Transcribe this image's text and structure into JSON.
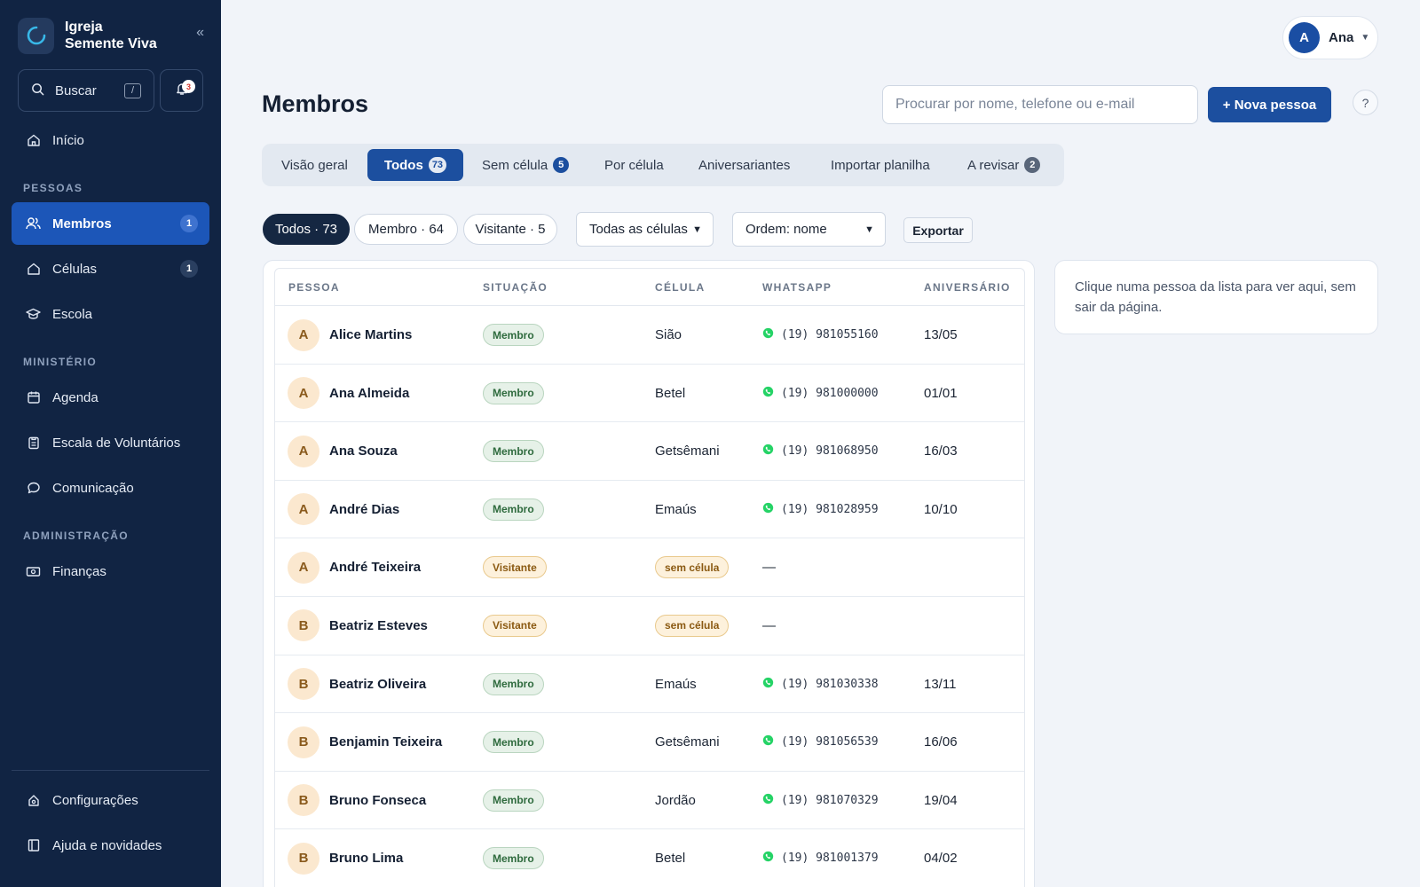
{
  "app": {
    "name": "Igreja\nSemente Viva",
    "name_line1": "Igreja",
    "name_line2": "Semente Viva"
  },
  "sidebar": {
    "search_label": "Buscar",
    "search_shortcut": "/",
    "notifications_count": "3",
    "home": "Início",
    "sections": {
      "people": "PESSOAS",
      "ministry": "MINISTÉRIO",
      "admin": "ADMINISTRAÇÃO"
    },
    "items": [
      {
        "label": "Membros",
        "count": "1",
        "icon": "users-icon",
        "active": true
      },
      {
        "label": "Células",
        "count": "1",
        "icon": "home-icon"
      },
      {
        "label": "Escola",
        "icon": "graduation-cap-icon"
      },
      {
        "label": "Agenda",
        "icon": "calendar-icon"
      },
      {
        "label": "Escala de Voluntários",
        "icon": "clipboard-icon"
      },
      {
        "label": "Comunicação",
        "icon": "chat-icon"
      },
      {
        "label": "Finanças",
        "icon": "money-icon"
      }
    ],
    "footer": [
      {
        "label": "Configurações",
        "icon": "settings-icon"
      },
      {
        "label": "Ajuda e novidades",
        "icon": "book-icon"
      }
    ]
  },
  "header": {
    "user_initial": "A",
    "user_name": "Ana",
    "title": "Membros",
    "search_placeholder": "Procurar por nome, telefone ou e-mail",
    "new_button": "+ Nova pessoa",
    "help": "?"
  },
  "tabs": [
    {
      "label": "Visão geral"
    },
    {
      "label": "Todos",
      "badge": "73",
      "active": true
    },
    {
      "label": "Sem célula",
      "badge": "5"
    },
    {
      "label": "Por célula"
    },
    {
      "label": "Aniversariantes"
    },
    {
      "label": "Importar planilha"
    },
    {
      "label": "A revisar",
      "badge": "2"
    }
  ],
  "filters": {
    "pills": [
      "Todos · 73",
      "Membro · 64",
      "Visitante · 5"
    ],
    "cell_select": "Todas as células",
    "order_select": "Ordem: nome",
    "export": "Exportar"
  },
  "table": {
    "headers": [
      "PESSOA",
      "SITUAÇÃO",
      "CÉLULA",
      "WHATSAPP",
      "ANIVERSÁRIO"
    ],
    "rows": [
      {
        "initial": "A",
        "name": "Alice Martins",
        "status": "Membro",
        "cell": "Sião",
        "whatsapp": "(19) 981055160",
        "birthday": "13/05"
      },
      {
        "initial": "A",
        "name": "Ana Almeida",
        "status": "Membro",
        "cell": "Betel",
        "whatsapp": "(19) 981000000",
        "birthday": "01/01"
      },
      {
        "initial": "A",
        "name": "Ana Souza",
        "status": "Membro",
        "cell": "Getsêmani",
        "whatsapp": "(19) 981068950",
        "birthday": "16/03"
      },
      {
        "initial": "A",
        "name": "André Dias",
        "status": "Membro",
        "cell": "Emaús",
        "whatsapp": "(19) 981028959",
        "birthday": "10/10"
      },
      {
        "initial": "A",
        "name": "André Teixeira",
        "status": "Visitante",
        "cell": "sem célula",
        "whatsapp": "—",
        "birthday": ""
      },
      {
        "initial": "B",
        "name": "Beatriz Esteves",
        "status": "Visitante",
        "cell": "sem célula",
        "whatsapp": "—",
        "birthday": ""
      },
      {
        "initial": "B",
        "name": "Beatriz Oliveira",
        "status": "Membro",
        "cell": "Emaús",
        "whatsapp": "(19) 981030338",
        "birthday": "13/11"
      },
      {
        "initial": "B",
        "name": "Benjamin Teixeira",
        "status": "Membro",
        "cell": "Getsêmani",
        "whatsapp": "(19) 981056539",
        "birthday": "16/06"
      },
      {
        "initial": "B",
        "name": "Bruno Fonseca",
        "status": "Membro",
        "cell": "Jordão",
        "whatsapp": "(19) 981070329",
        "birthday": "19/04"
      },
      {
        "initial": "B",
        "name": "Bruno Lima",
        "status": "Membro",
        "cell": "Betel",
        "whatsapp": "(19) 981001379",
        "birthday": "04/02"
      }
    ]
  },
  "side_panel": {
    "text": "Clique numa pessoa da lista para ver aqui, sem sair da página."
  },
  "colors": {
    "sidebar": "#112443",
    "accent": "#1c4f9f",
    "active_nav": "#1c56b8",
    "whatsapp": "#25d366"
  }
}
